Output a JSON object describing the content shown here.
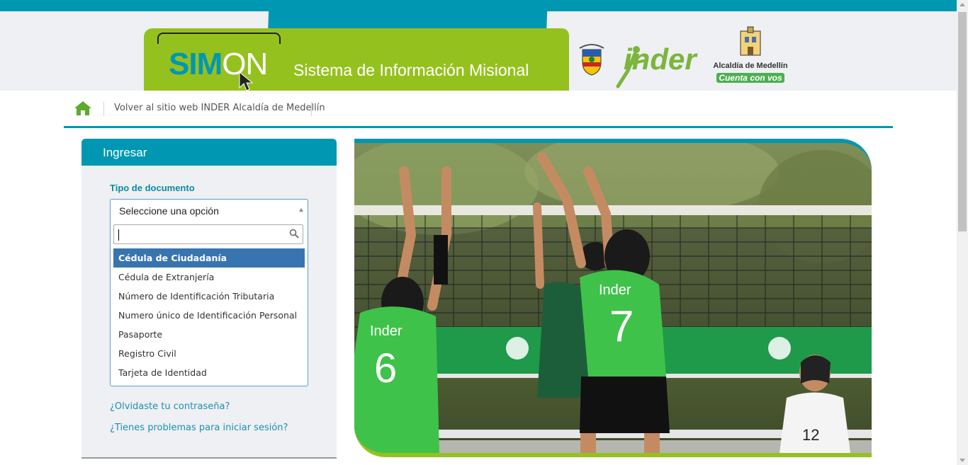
{
  "header": {
    "logo_part1": "SIM",
    "logo_part2": "ON",
    "title": "Sistema de Información Misional",
    "inder_logo": "inder",
    "alcaldia_name": "Alcaldía de Medellín",
    "alcaldia_slogan": "Cuenta con vos",
    "colors": {
      "teal": "#0097b2",
      "green": "#95c11f"
    }
  },
  "nav": {
    "home_icon": "home-icon",
    "back_link": "Volver al sitio web INDER Alcaldía de Medellín"
  },
  "login": {
    "panel_title": "Ingresar",
    "doc_type_label": "Tipo de documento",
    "select": {
      "value": "Seleccione una opción",
      "search_value": "",
      "options": [
        {
          "label": "Cédula de Ciudadanía",
          "highlighted": true
        },
        {
          "label": "Cédula de Extranjería",
          "highlighted": false
        },
        {
          "label": "Número de Identificación Tributaria",
          "highlighted": false
        },
        {
          "label": "Numero único de Identificación Personal",
          "highlighted": false
        },
        {
          "label": "Pasaporte",
          "highlighted": false
        },
        {
          "label": "Registro Civil",
          "highlighted": false
        },
        {
          "label": "Tarjeta de Identidad",
          "highlighted": false
        }
      ]
    },
    "forgot_password": "¿Olvidaste tu contraseña?",
    "login_problems": "¿Tienes problemas para iniciar sesión?"
  },
  "hero": {
    "jersey_numbers": [
      "6",
      "7",
      "12"
    ],
    "jersey_text": "Inder"
  }
}
